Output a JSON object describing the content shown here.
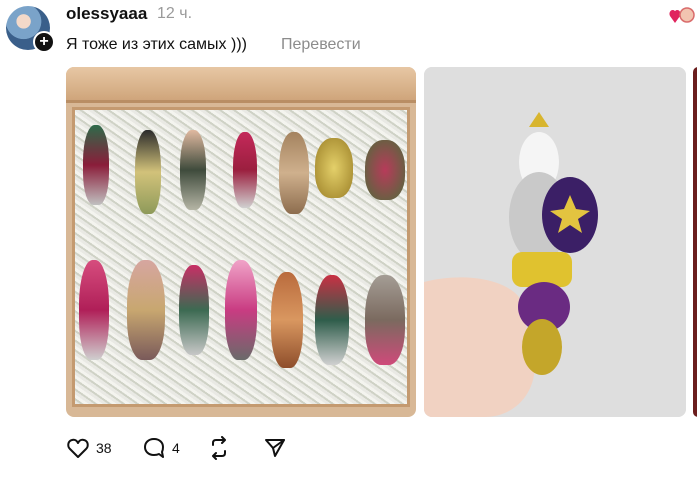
{
  "post": {
    "username": "olessyaaa",
    "time": "12 ч.",
    "text": "Я тоже из этих самых )))",
    "translate_label": "Перевести"
  },
  "actions": {
    "likes": "38",
    "comments": "4"
  },
  "icons": {
    "avatar_plus": "+",
    "like": "heart-icon",
    "comment": "comment-icon",
    "repost": "repost-icon",
    "share": "share-icon"
  }
}
